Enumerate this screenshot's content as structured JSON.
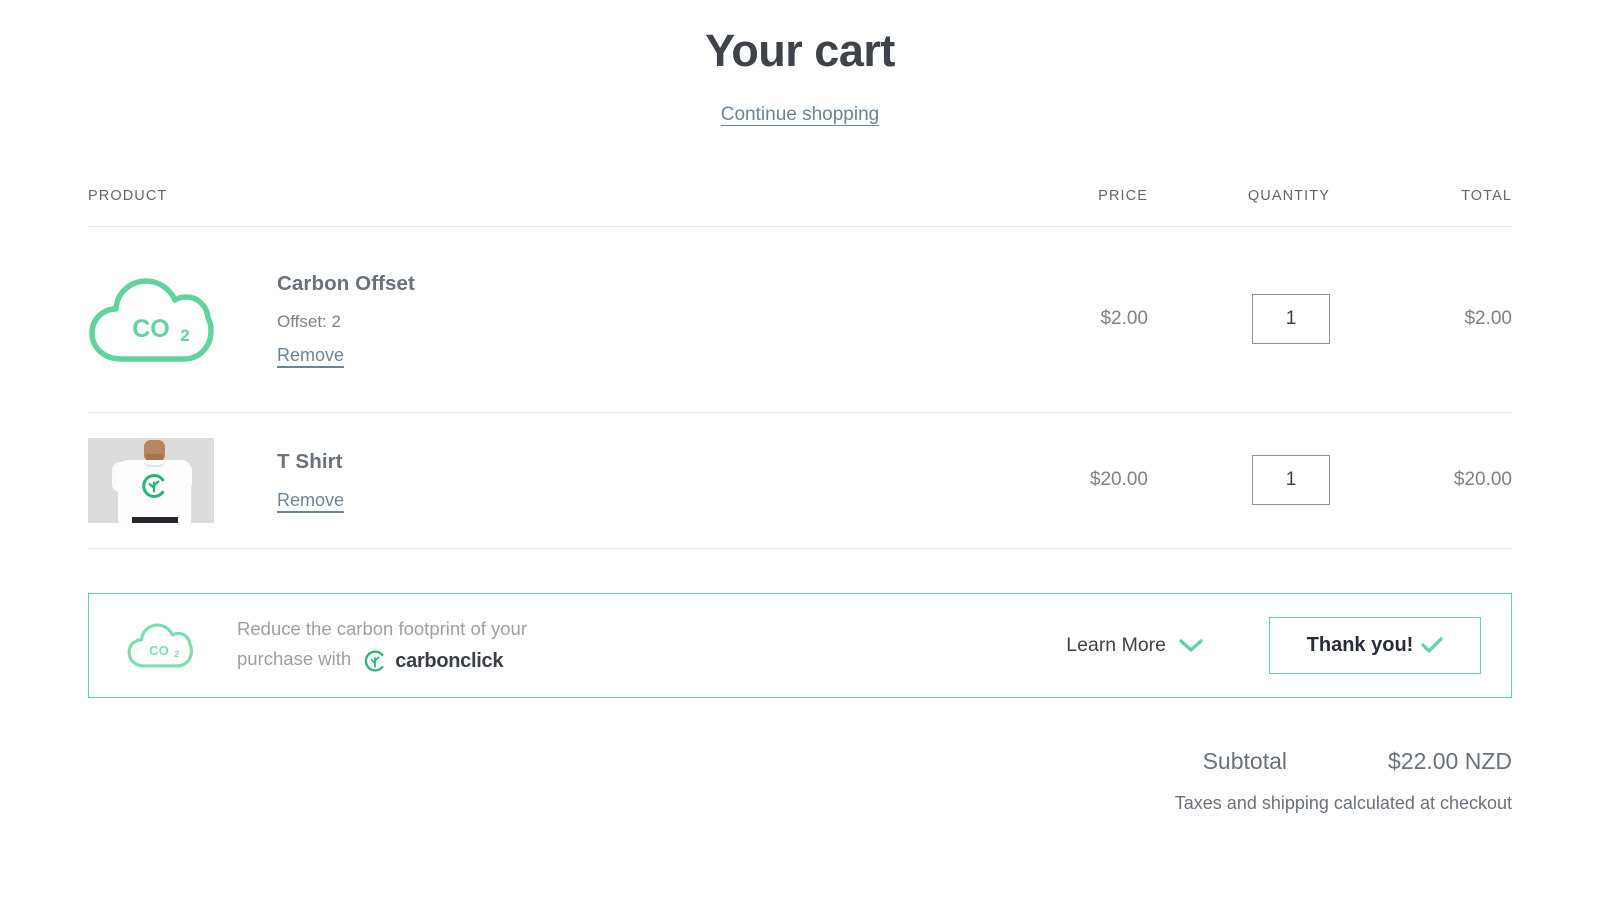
{
  "header": {
    "title": "Your cart",
    "continue_shopping": "Continue shopping"
  },
  "table": {
    "columns": {
      "product": "PRODUCT",
      "price": "PRICE",
      "quantity": "QUANTITY",
      "total": "TOTAL"
    },
    "rows": [
      {
        "icon": "co2-cloud-icon",
        "title": "Carbon Offset",
        "meta": "Offset: 2",
        "remove_label": "Remove",
        "price": "$2.00",
        "quantity": "1",
        "total": "$2.00"
      },
      {
        "icon": "tshirt-photo",
        "title": "T Shirt",
        "meta": "",
        "remove_label": "Remove",
        "price": "$20.00",
        "quantity": "1",
        "total": "$20.00"
      }
    ]
  },
  "carbonclick_banner": {
    "icon": "co2-cloud-icon",
    "message_line1": "Reduce the carbon footprint of your",
    "message_line2": "purchase with",
    "brand_name": "carbonclick",
    "brand_icon": "carbonclick-logo-icon",
    "learn_more_label": "Learn More",
    "learn_more_icon": "chevron-down-icon",
    "thank_you_label": "Thank you!",
    "thank_you_icon": "check-icon"
  },
  "totals": {
    "subtotal_label": "Subtotal",
    "subtotal_value": "$22.00 NZD",
    "taxes_note": "Taxes and shipping calculated at checkout"
  },
  "colors": {
    "accent_green": "#62d39f",
    "link_blue": "#6b8499",
    "text_dark": "#3d4348",
    "text_muted": "#7b828a",
    "divider": "#e6e6e6"
  }
}
